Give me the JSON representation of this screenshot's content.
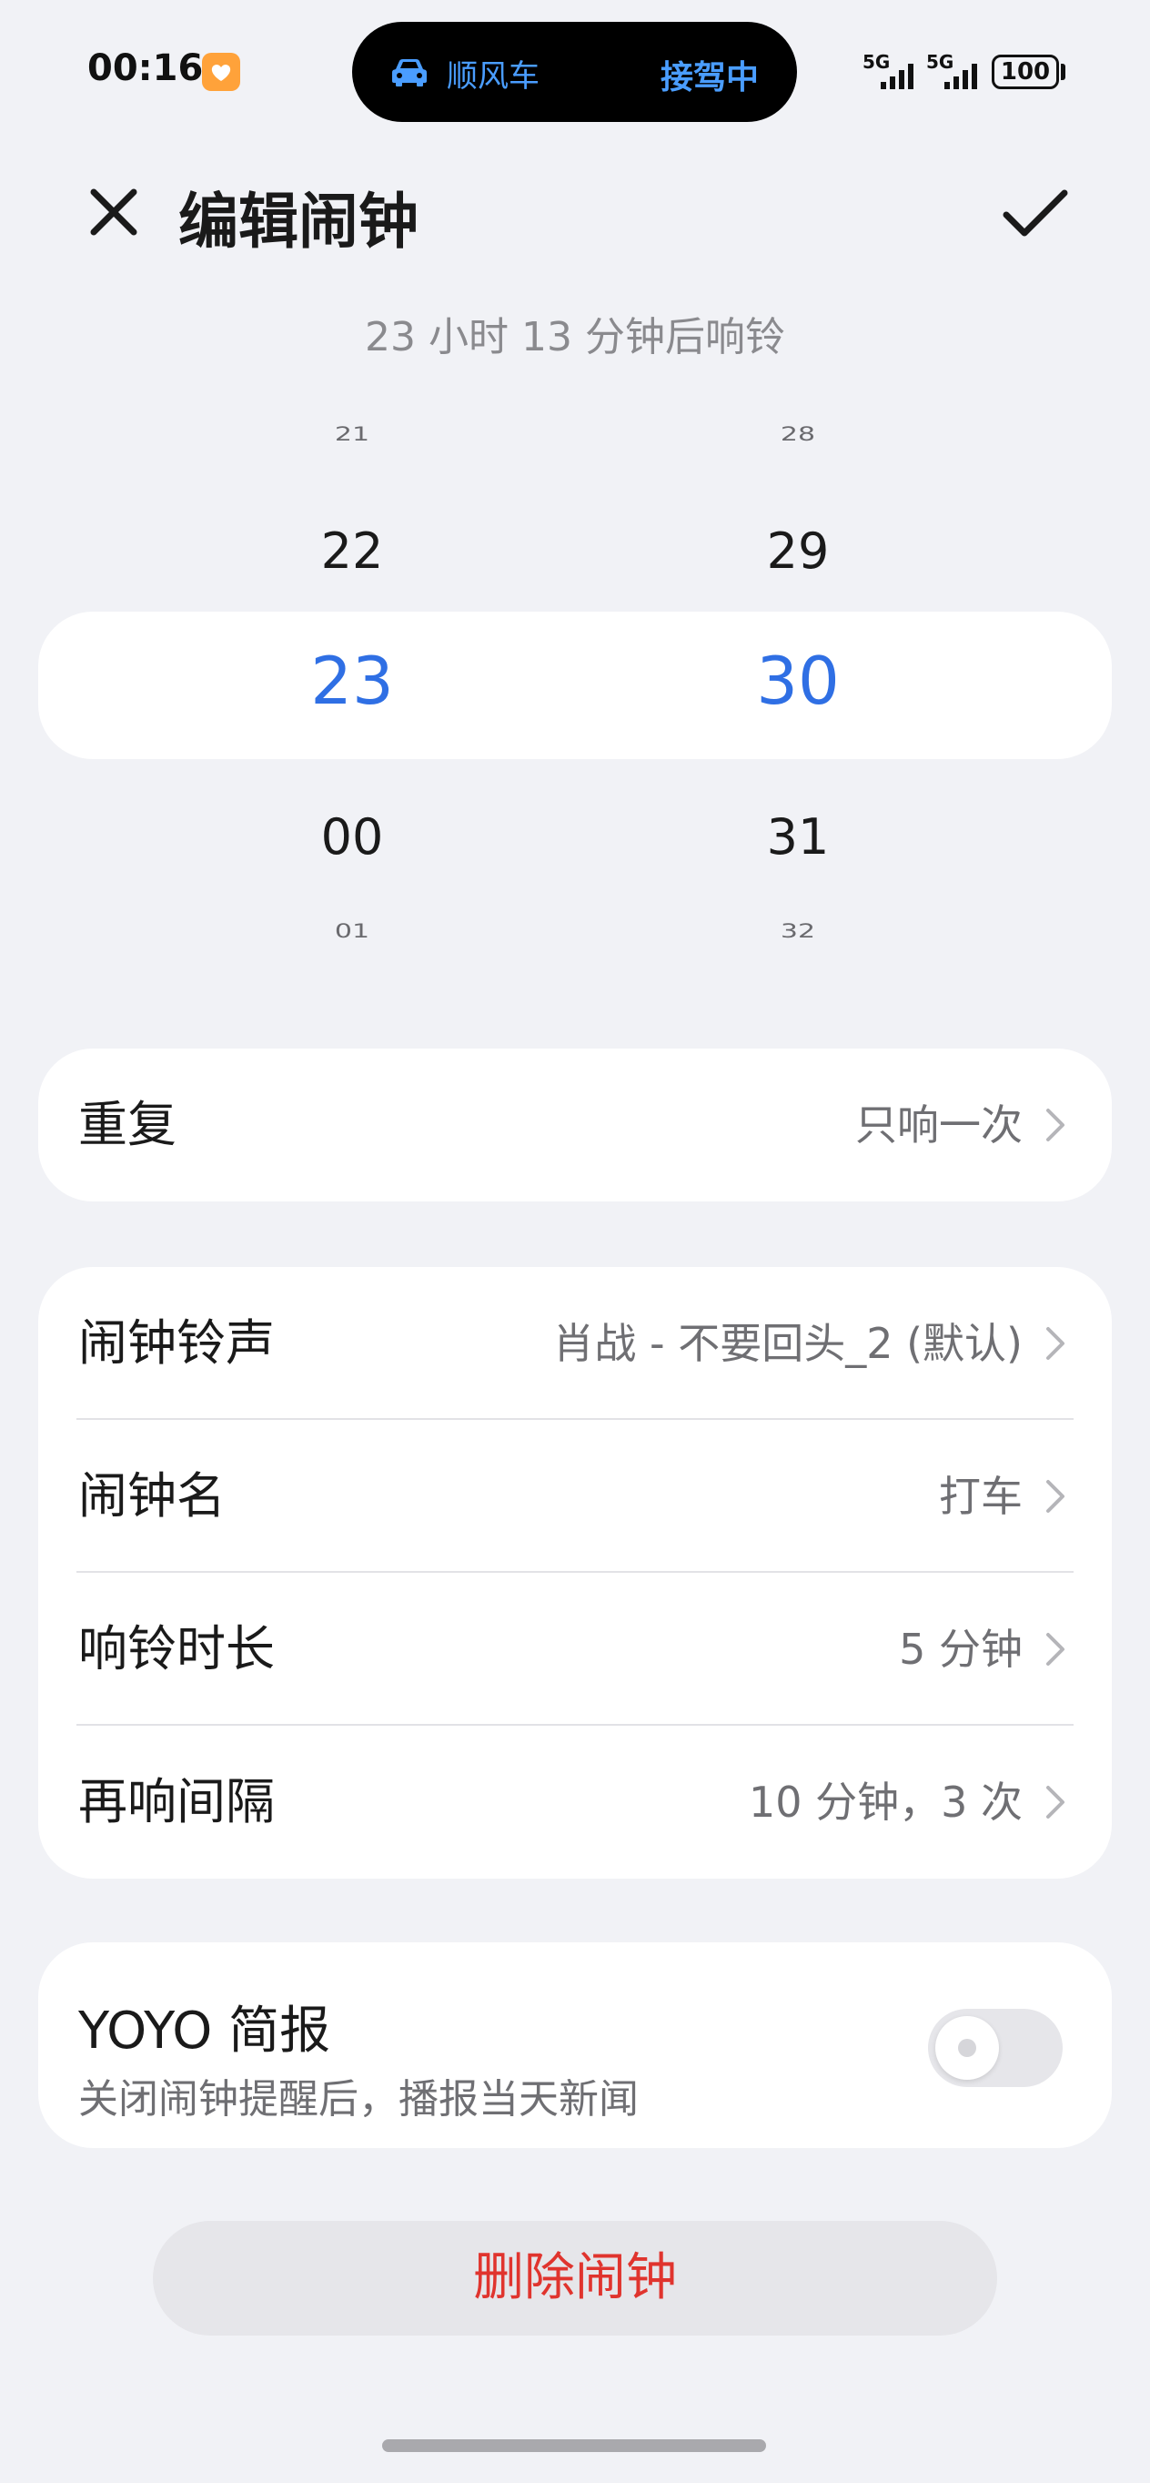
{
  "status_bar": {
    "time": "00:16",
    "island_left": "顺风车",
    "island_right": "接驾中",
    "signal_1": "5G",
    "signal_2": "5G",
    "battery": "100",
    "accent_color": "#4a9dff"
  },
  "header": {
    "title": "编辑闹钟",
    "subtitle": "23 小时 13 分钟后响铃"
  },
  "time_picker": {
    "hours": [
      "21",
      "22",
      "23",
      "00",
      "01"
    ],
    "minutes": [
      "28",
      "29",
      "30",
      "31",
      "32"
    ],
    "selected_hour": "23",
    "selected_minute": "30",
    "selected_color": "#2f6fe4"
  },
  "repeat_card": {
    "label": "重复",
    "value": "只响一次"
  },
  "settings_card": {
    "rows": [
      {
        "label": "闹钟铃声",
        "value": "肖战 - 不要回头_2 (默认)"
      },
      {
        "label": "闹钟名",
        "value": "打车"
      },
      {
        "label": "响铃时长",
        "value": "5 分钟"
      },
      {
        "label": "再响间隔",
        "value": "10 分钟，3 次"
      }
    ]
  },
  "yoyo_card": {
    "title": "YOYO 简报",
    "subtitle": "关闭闹钟提醒后，播报当天新闻",
    "enabled": false
  },
  "delete_label": "删除闹钟",
  "delete_color": "#e0342e"
}
